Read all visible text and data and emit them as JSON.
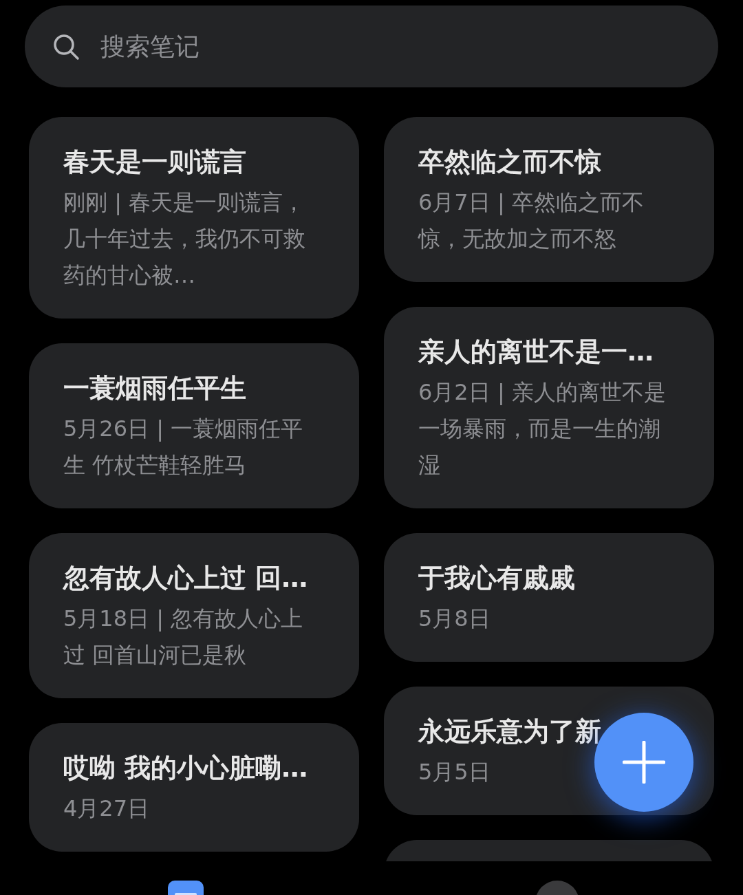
{
  "search": {
    "placeholder": "搜索笔记"
  },
  "columns": [
    {
      "notes": [
        {
          "kind": "note",
          "title": "春天是一则谎言",
          "snippet": "刚刚 | 春天是一则谎言，几十年过去，我仍不可救药的甘心被…"
        },
        {
          "kind": "note",
          "title": "一蓑烟雨任平生",
          "snippet": "5月26日 | 一蓑烟雨任平生  竹杖芒鞋轻胜马"
        },
        {
          "kind": "note",
          "title": "忽有故人心上过 回…",
          "snippet": "5月18日 | 忽有故人心上过 回首山河已是秋"
        },
        {
          "kind": "note",
          "title": "哎呦 我的小心脏嘞…",
          "snippet": "4月27日"
        }
      ]
    },
    {
      "notes": [
        {
          "kind": "note",
          "title": "卒然临之而不惊",
          "snippet": "6月7日 | 卒然临之而不惊，无故加之而不怒"
        },
        {
          "kind": "note",
          "title": "亲人的离世不是一…",
          "snippet": "6月2日 | 亲人的离世不是一场暴雨，而是一生的潮湿"
        },
        {
          "kind": "note",
          "title": "于我心有戚戚",
          "snippet": "5月8日"
        },
        {
          "kind": "note",
          "title": "永远乐意为了新",
          "snippet": "5月5日"
        },
        {
          "kind": "partial"
        }
      ]
    }
  ],
  "nav": [
    {
      "kind": "notes",
      "selected": true
    },
    {
      "kind": "todo",
      "selected": false
    }
  ]
}
